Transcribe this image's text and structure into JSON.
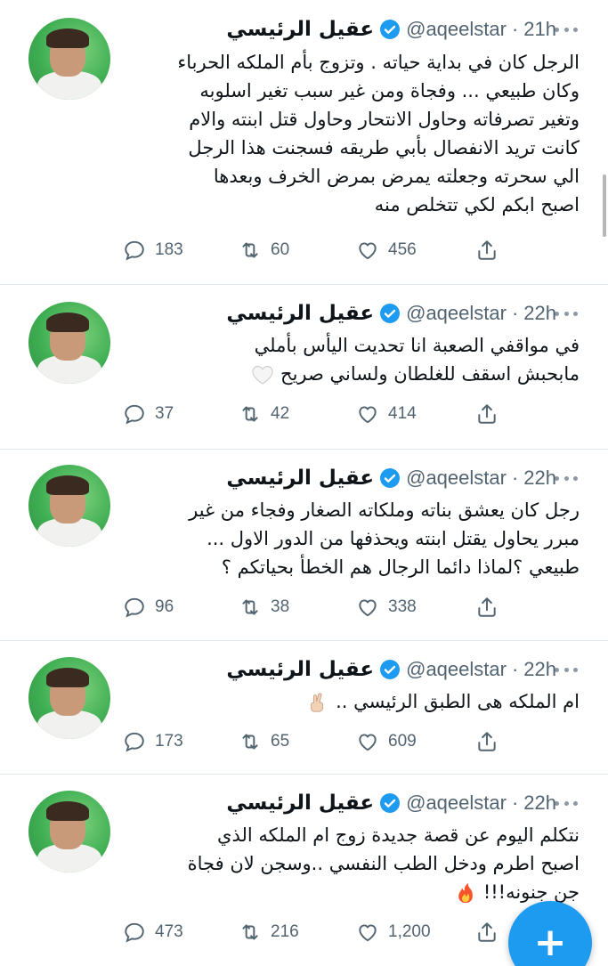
{
  "profile": {
    "name": "عقيل الرئيسي",
    "handle": "@aqeelstar",
    "separator": "·"
  },
  "tweets": [
    {
      "time": "21h",
      "lines": [
        "الرجل كان في بداية حياته . وتزوج بأم الملكه الحرباء",
        "وكان طبيعي ... وفجاة ومن غير سبب  تغير اسلوبه",
        "وتغير تصرفاته وحاول الانتحار وحاول قتل ابنته والام",
        "كانت تريد الانفصال بأبي طريقه فسجنت هذا الرجل",
        "الي سحرته وجعلته يمرض بمرض الخرف وبعدها",
        "اصبح ابكم  لكي تتخلص منه"
      ],
      "replies": "183",
      "retweets": "60",
      "likes": "456"
    },
    {
      "time": "22h",
      "lines": [
        "في مواقفي الصعبة انا تحديت اليأس بأملي",
        "مابحبش اسقف للغلطان ولساني صريح"
      ],
      "emoji": "white-heart",
      "replies": "37",
      "retweets": "42",
      "likes": "414"
    },
    {
      "time": "22h",
      "lines": [
        "رجل كان يعشق بناته وملكاته الصغار وفجاء من غير",
        "مبرر يحاول يقتل ابنته ويحذفها من الدور الاول ...",
        "طبيعي ؟لماذا دائما الرجال هم الخطأ بحياتكم ؟"
      ],
      "replies": "96",
      "retweets": "38",
      "likes": "338"
    },
    {
      "time": "22h",
      "lines": [
        "ام الملكه هى الطبق الرئيسي .."
      ],
      "emoji": "crossed-fingers",
      "replies": "173",
      "retweets": "65",
      "likes": "609"
    },
    {
      "time": "22h",
      "lines": [
        "نتكلم اليوم عن قصة جديدة زوج ام الملكه الذي",
        "اصبح اطرم ودخل الطب النفسي ..وسجن لان فجاة",
        "جن جنونه!!!"
      ],
      "emoji": "fire",
      "replies": "473",
      "retweets": "216",
      "likes": "1,200"
    }
  ],
  "fab": {
    "label": "+",
    "icon": "compose-plus-icon",
    "color": "#1d9bf0"
  },
  "colors": {
    "accent": "#1d9bf0",
    "muted": "#536471",
    "divider": "#e1e8ed"
  }
}
